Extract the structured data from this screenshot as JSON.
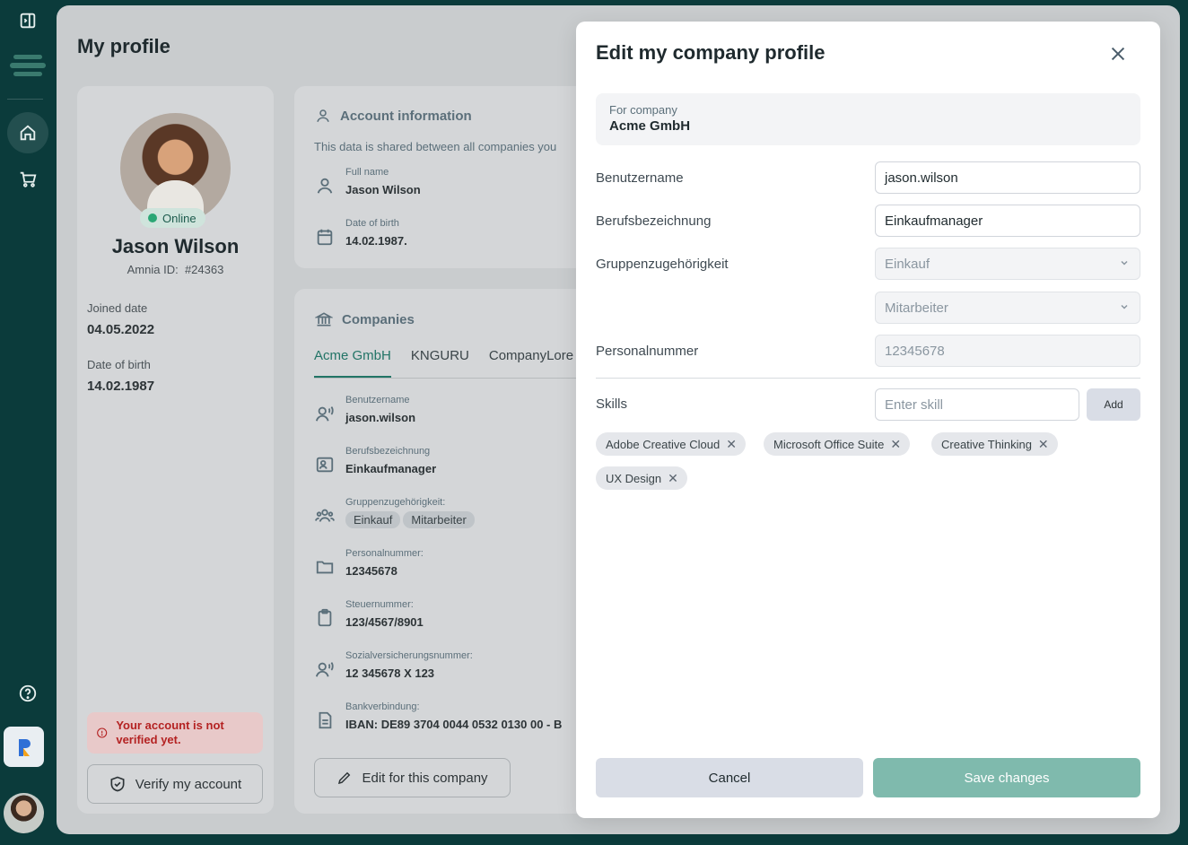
{
  "rail": {
    "icons": [
      "sidebar-toggle-icon",
      "logo-icon",
      "home-icon",
      "cart-icon",
      "help-icon",
      "app-logo-icon",
      "user-avatar"
    ]
  },
  "page": {
    "title": "My profile"
  },
  "profile": {
    "status": "Online",
    "name": "Jason Wilson",
    "id_label": "Amnia ID:",
    "id_value": "#24363",
    "joined_label": "Joined date",
    "joined_value": "04.05.2022",
    "dob_label": "Date of birth",
    "dob_value": "14.02.1987",
    "warning": "Your account is not verified yet.",
    "verify_label": "Verify my account"
  },
  "account": {
    "title": "Account information",
    "subtitle": "This data is shared between all companies you",
    "fullname_label": "Full name",
    "fullname_value": "Jason Wilson",
    "dob_label": "Date of birth",
    "dob_value": "14.02.1987."
  },
  "companies": {
    "title": "Companies",
    "tabs": [
      "Acme GmbH",
      "KNGURU",
      "CompanyLore"
    ],
    "fields": [
      {
        "label": "Benutzername",
        "value": "jason.wilson"
      },
      {
        "label": "Berufsbezeichnung",
        "value": "Einkaufmanager"
      },
      {
        "label": "Gruppenzugehörigkeit:",
        "value": ""
      },
      {
        "label": "Personalnummer:",
        "value": "12345678"
      },
      {
        "label": "Steuernummer:",
        "value": "123/4567/8901"
      },
      {
        "label": "Sozialversicherungsnummer:",
        "value": "12 345678 X 123"
      },
      {
        "label": "Bankverbindung:",
        "value": "IBAN: DE89 3704 0044 0532 0130 00 - B"
      }
    ],
    "groups": [
      "Einkauf",
      "Mitarbeiter"
    ],
    "edit_label": "Edit for this company"
  },
  "modal": {
    "title": "Edit my company profile",
    "company_caption": "For company",
    "company_name": "Acme GmbH",
    "username_label": "Benutzername",
    "username_value": "jason.wilson",
    "job_label": "Berufsbezeichnung",
    "job_value": "Einkaufmanager",
    "group_label": "Gruppenzugehörigkeit",
    "group_value1": "Einkauf",
    "group_value2": "Mitarbeiter",
    "personal_label": "Personalnummer",
    "personal_value": "12345678",
    "skills_label": "Skills",
    "skill_placeholder": "Enter skill",
    "add_label": "Add",
    "skills": [
      "Adobe Creative Cloud",
      "Microsoft Office Suite",
      "Creative Thinking",
      "UX Design"
    ],
    "cancel_label": "Cancel",
    "save_label": "Save changes"
  }
}
